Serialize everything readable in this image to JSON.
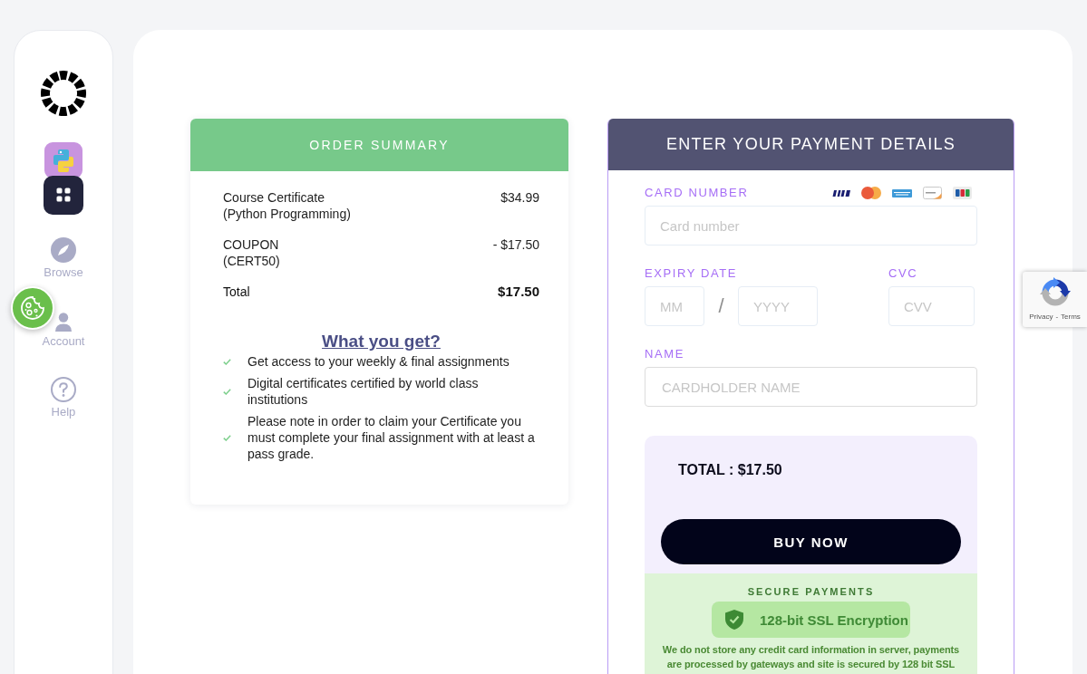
{
  "sidebar": {
    "nav": [
      {
        "label": "Browse",
        "selected": false
      },
      {
        "label": "Account",
        "selected": false
      },
      {
        "label": "Help",
        "selected": false
      }
    ]
  },
  "order_summary": {
    "title": "ORDER SUMMARY",
    "lines": [
      {
        "label": "Course Certificate",
        "detail": "(Python Programming)",
        "amount": "$34.99"
      },
      {
        "label": "COUPON",
        "detail": "(CERT50)",
        "amount": "- $17.50"
      }
    ],
    "total": {
      "label": "Total",
      "amount": "$17.50"
    },
    "benefits": {
      "heading": "What you get?",
      "items": [
        "Get access to your weekly & final assignments",
        "Digital certificates certified by world class institutions",
        "Please note in order to claim your Certificate you must complete your final assignment with at least a pass grade."
      ]
    }
  },
  "payment": {
    "title": "ENTER YOUR PAYMENT DETAILS",
    "card_number": {
      "label": "CARD NUMBER",
      "placeholder": "Card number"
    },
    "expiry": {
      "label": "EXPIRY DATE",
      "month_placeholder": "MM",
      "separator": "/",
      "year_placeholder": "YYYY"
    },
    "cvc": {
      "label": "CVC",
      "placeholder": "CVV"
    },
    "name": {
      "label": "NAME",
      "placeholder": "CARDHOLDER NAME"
    },
    "checkout": {
      "total": "TOTAL : $17.50",
      "button": "BUY NOW"
    },
    "secure": {
      "title": "SECURE PAYMENTS",
      "badge": "128-bit SSL Encryption",
      "note": "We do not store any credit card information in server, payments are processed by gateways and site is secured by 128 bit SSL"
    }
  },
  "recaptcha": {
    "links": [
      "Privacy",
      "Terms"
    ],
    "separator": "-"
  }
}
